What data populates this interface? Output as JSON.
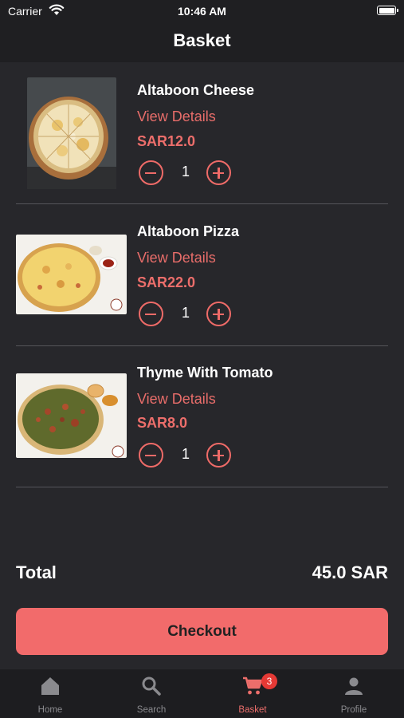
{
  "status_bar": {
    "carrier": "Carrier",
    "time": "10:46 AM"
  },
  "header": {
    "title": "Basket"
  },
  "basket": {
    "items": [
      {
        "name": "Altaboon Cheese",
        "details_label": "View Details",
        "price": "SAR12.0",
        "quantity": "1"
      },
      {
        "name": "Altaboon Pizza",
        "details_label": "View Details",
        "price": "SAR22.0",
        "quantity": "1"
      },
      {
        "name": "Thyme With Tomato",
        "details_label": "View Details",
        "price": "SAR8.0",
        "quantity": "1"
      }
    ]
  },
  "summary": {
    "total_label": "Total",
    "total_value": "45.0 SAR"
  },
  "checkout": {
    "label": "Checkout"
  },
  "tabs": [
    {
      "label": "Home",
      "icon": "home-icon"
    },
    {
      "label": "Search",
      "icon": "search-icon"
    },
    {
      "label": "Basket",
      "icon": "cart-icon",
      "badge": "3",
      "active": true
    },
    {
      "label": "Profile",
      "icon": "person-icon"
    }
  ],
  "colors": {
    "accent": "#f26b6b",
    "background": "#27272b",
    "bar": "#1f1f22",
    "badge": "#e53935"
  }
}
